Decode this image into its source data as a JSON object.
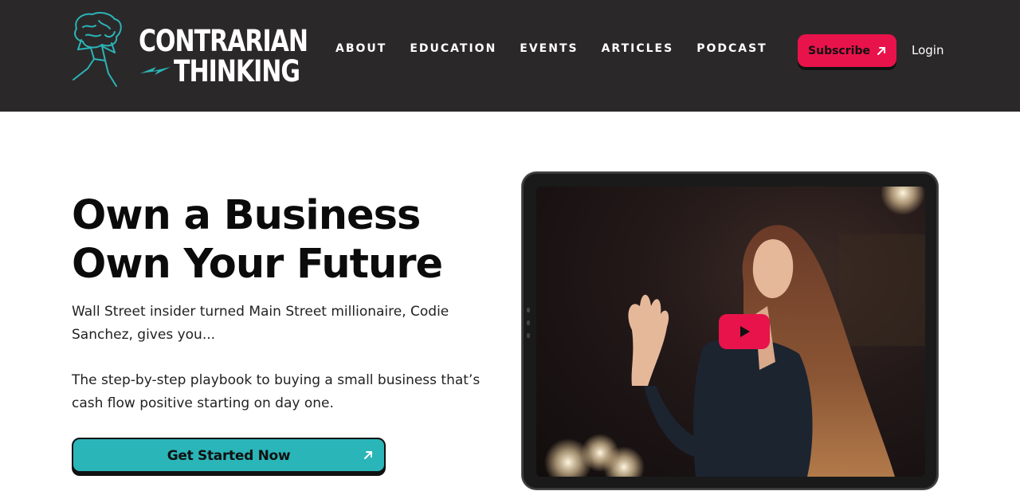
{
  "brand": {
    "line1": "Contrarian",
    "line2": "Thinking",
    "accent_color": "#2ab5b8"
  },
  "nav": {
    "items": [
      {
        "label": "ABOUT"
      },
      {
        "label": "EDUCATION"
      },
      {
        "label": "EVENTS"
      },
      {
        "label": "ARTICLES"
      },
      {
        "label": "PODCAST"
      }
    ],
    "subscribe_label": "Subscribe",
    "subscribe_icon": "arrow-up-right-icon",
    "login_label": "Login"
  },
  "hero": {
    "title_line1": "Own a Business",
    "title_line2": "Own Your Future",
    "subtitle": "Wall Street insider turned Main Street millionaire, Codie Sanchez, gives you...",
    "description": "The step-by-step playbook to buying a small business that’s cash flow positive starting on day one.",
    "cta_label": "Get Started Now",
    "cta_icon": "arrow-up-right-icon"
  },
  "video": {
    "play_icon": "play-icon",
    "play_color": "#e8134b"
  },
  "colors": {
    "header_bg": "#2b2829",
    "subscribe_bg": "#e8134b",
    "cta_bg": "#2ab5b8"
  }
}
